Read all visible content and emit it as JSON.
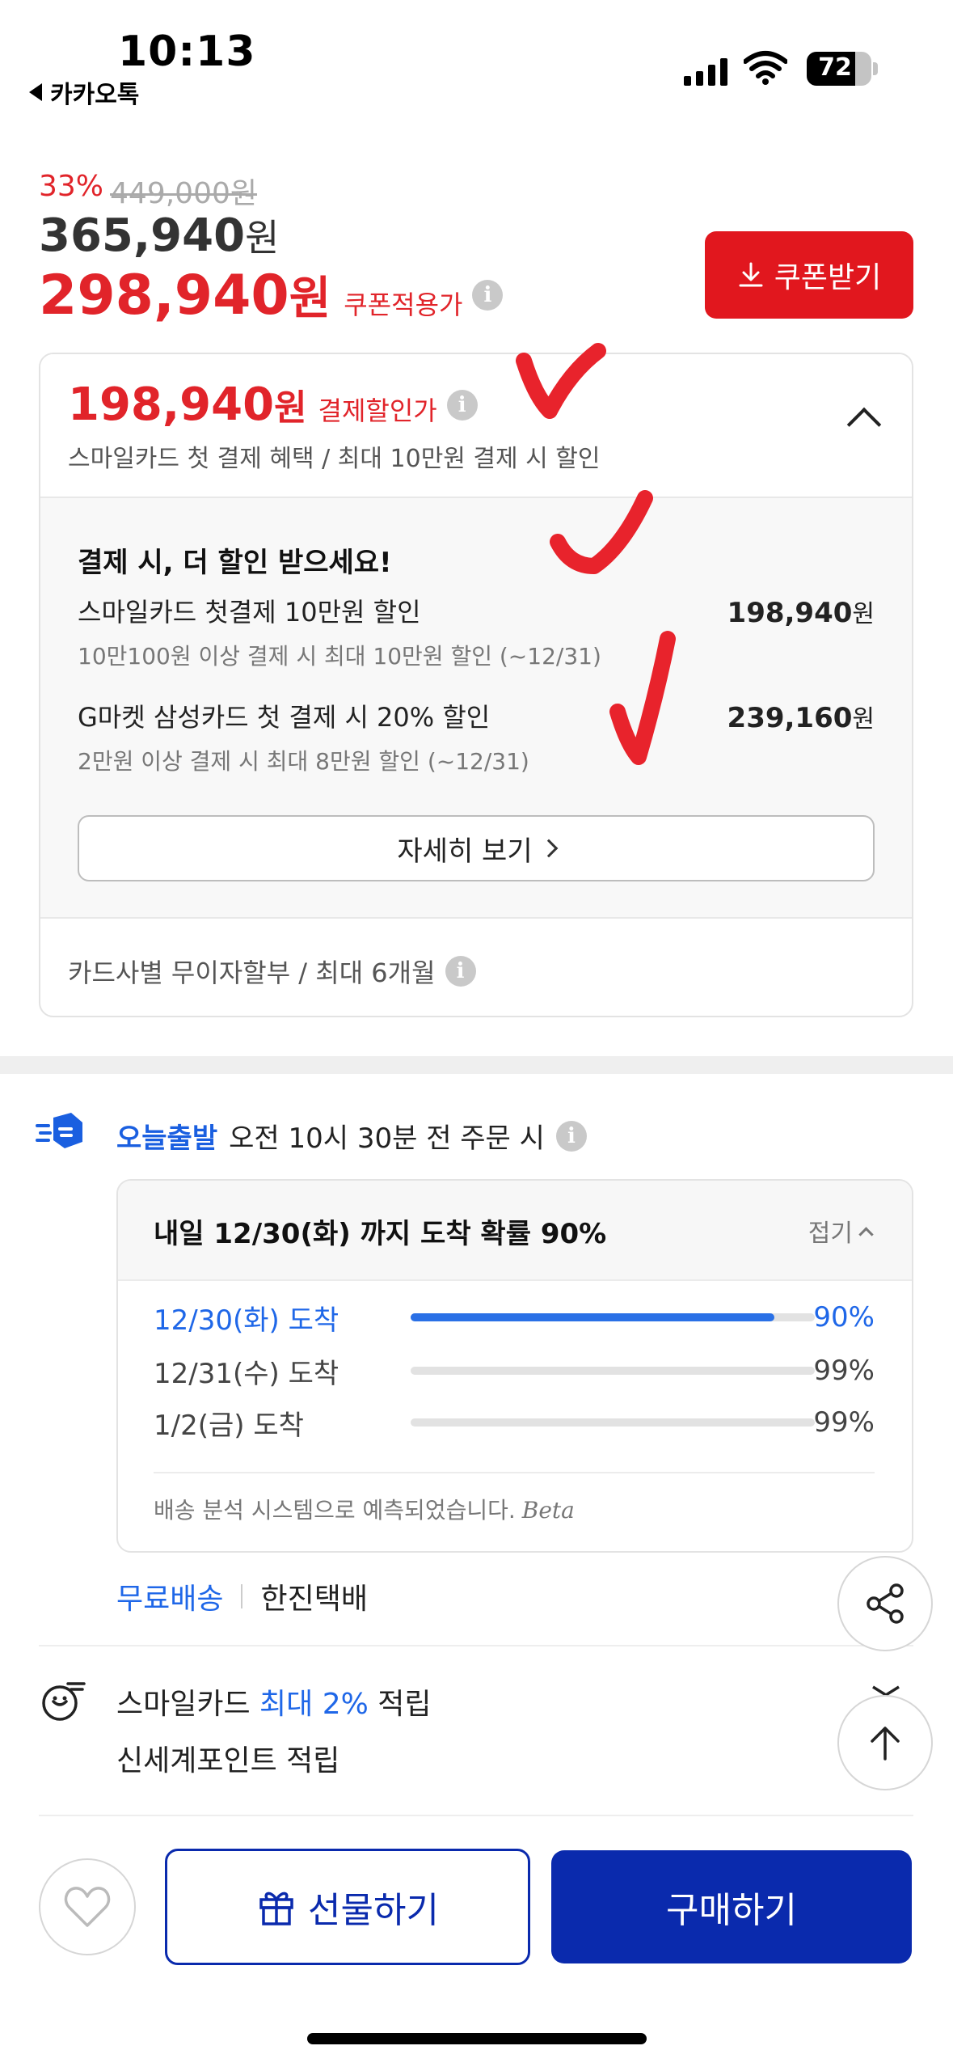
{
  "status_bar": {
    "time": "10:13",
    "back_app": "카카오톡",
    "battery": "72"
  },
  "product": {
    "discount_pct": "33%",
    "original_price": "449,000원",
    "price_num": "365,940",
    "price_unit": "원",
    "coupon_price_num": "298,940",
    "coupon_price_unit": "원",
    "coupon_price_label": "쿠폰적용가",
    "coupon_button": "쿠폰받기"
  },
  "payment": {
    "price_num": "198,940",
    "price_unit": "원",
    "label": "결제할인가",
    "subtitle": "스마일카드 첫 결제 혜택 / 최대 10만원 결제 시 할인",
    "body_title": "결제 시, 더 할인 받으세요!",
    "offers": [
      {
        "name": "스마일카드 첫결제 10만원 할인",
        "desc": "10만100원 이상 결제 시 최대 10만원 할인 (~12/31)",
        "amount": "198,940",
        "unit": "원"
      },
      {
        "name": "G마켓 삼성카드 첫 결제 시 20% 할인",
        "desc": "2만원 이상 결제 시 최대 8만원 할인 (~12/31)",
        "amount": "239,160",
        "unit": "원"
      }
    ],
    "detail_button": "자세히 보기",
    "installment": "카드사별 무이자할부 / 최대 6개월"
  },
  "delivery": {
    "brand": "오늘출발",
    "condition": "오전 10시 30분 전 주문 시",
    "arrival_title": "내일 12/30(화) 까지 도착 확률 90%",
    "fold_label": "접기",
    "rows": [
      {
        "label": "12/30(화) 도착",
        "pct": "90%",
        "value": 0.9
      },
      {
        "label": "12/31(수) 도착",
        "pct": "99%",
        "value": 0.0
      },
      {
        "label": "1/2(금) 도착",
        "pct": "99%",
        "value": 0.0
      }
    ],
    "note": "배송 분석 시스템으로 예측되었습니다.",
    "note_badge": "Beta",
    "shipping_free": "무료배송",
    "carrier": "한진택배"
  },
  "rewards": {
    "line1_prefix": "스마일카드 ",
    "line1_highlight": "최대 2%",
    "line1_suffix": " 적립",
    "line2": "신세계포인트 적립"
  },
  "bottom": {
    "gift_button": "선물하기",
    "buy_button": "구매하기"
  },
  "colors": {
    "accent_red": "#e1171e",
    "brand_blue": "#0a2aad",
    "link_blue": "#1f67e8",
    "annotation_red": "#e8232c"
  },
  "icons": [
    "back-arrow-icon",
    "signal-icon",
    "wifi-icon",
    "battery-icon",
    "info-icon",
    "download-icon",
    "chevron-up-icon",
    "chevron-right-icon",
    "truck-icon",
    "coin-icon",
    "share-icon",
    "arrow-up-icon",
    "heart-icon",
    "gift-icon"
  ]
}
